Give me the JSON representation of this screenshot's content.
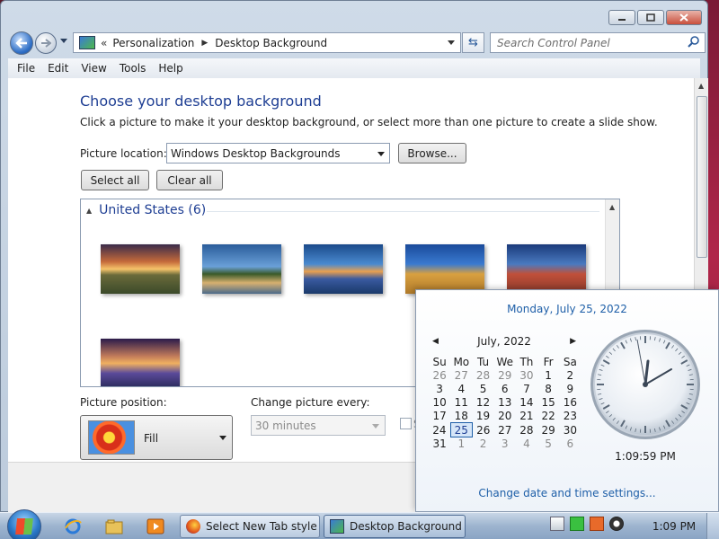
{
  "window": {
    "breadcrumb": {
      "lead": "«",
      "part1": "Personalization",
      "part2": "Desktop Background"
    },
    "search_placeholder": "Search Control Panel"
  },
  "menu": [
    "File",
    "Edit",
    "View",
    "Tools",
    "Help"
  ],
  "page": {
    "heading": "Choose your desktop background",
    "description": "Click a picture to make it your desktop background, or select more than one picture to create a slide show.",
    "picture_location_label": "Picture location:",
    "picture_location_value": "Windows Desktop Backgrounds",
    "browse_label": "Browse...",
    "select_all_label": "Select all",
    "clear_all_label": "Clear all",
    "group_heading": "United States (6)",
    "picture_position_label": "Picture position:",
    "picture_position_value": "Fill",
    "change_picture_label": "Change picture every:",
    "change_picture_value": "30 minutes",
    "shuffle_partial": "S"
  },
  "popup": {
    "date_heading": "Monday, July 25, 2022",
    "month_label": "July, 2022",
    "weekdays": [
      "Su",
      "Mo",
      "Tu",
      "We",
      "Th",
      "Fr",
      "Sa"
    ],
    "weeks": [
      [
        "26",
        "27",
        "28",
        "29",
        "30",
        "1",
        "2"
      ],
      [
        "3",
        "4",
        "5",
        "6",
        "7",
        "8",
        "9"
      ],
      [
        "10",
        "11",
        "12",
        "13",
        "14",
        "15",
        "16"
      ],
      [
        "17",
        "18",
        "19",
        "20",
        "21",
        "22",
        "23"
      ],
      [
        "24",
        "25",
        "26",
        "27",
        "28",
        "29",
        "30"
      ],
      [
        "31",
        "1",
        "2",
        "3",
        "4",
        "5",
        "6"
      ]
    ],
    "time": "1:09:59 PM",
    "change_link": "Change date and time settings..."
  },
  "taskbar": {
    "task1": "Select New Tab style ...",
    "task2": "Desktop Background",
    "clock": "1:09 PM"
  },
  "colors": {
    "link": "#1e5fa8",
    "heading": "#1e3e93"
  }
}
